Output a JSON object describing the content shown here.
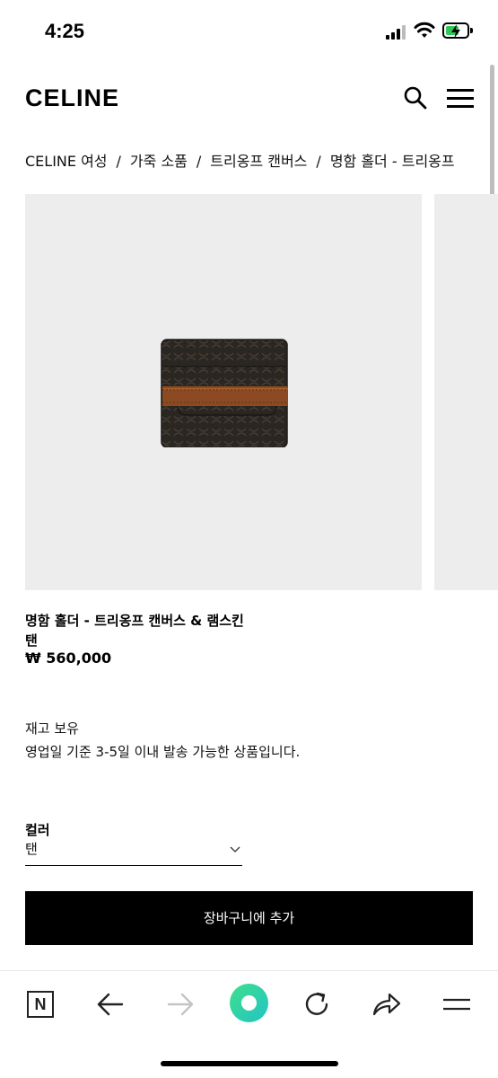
{
  "status_bar": {
    "time": "4:25"
  },
  "header": {
    "logo": "CELINE",
    "search_icon": "search-icon",
    "menu_icon": "hamburger-menu-icon"
  },
  "breadcrumb": {
    "items": [
      "CELINE 여성",
      "가죽 소품",
      "트리옹프 캔버스",
      "명함 홀더 - 트리옹프"
    ],
    "separator": "/"
  },
  "product": {
    "name": "명함 홀더 - 트리옹프 캔버스 & 램스킨",
    "color": "탠",
    "price": "₩ 560,000",
    "stock_status": "재고 보유",
    "shipping_note": "영업일 기준 3-5일 이내 발송 가능한 상품입니다."
  },
  "color_selector": {
    "label": "컬러",
    "selected": "탠"
  },
  "cart": {
    "add_label": "장바구니에 추가"
  },
  "browser_toolbar": {
    "items": [
      "naver-n-icon",
      "back-arrow-icon",
      "forward-arrow-icon",
      "green-home-button",
      "reload-icon",
      "share-icon",
      "menu-icon"
    ]
  },
  "colors": {
    "button_bg": "#000000",
    "image_bg": "#ededed",
    "accent_green": "#32c759"
  }
}
